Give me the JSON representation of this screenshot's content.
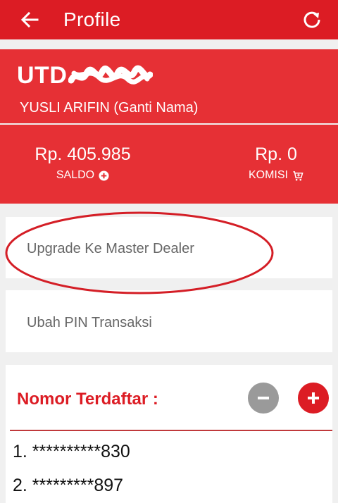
{
  "header": {
    "title": "Profile",
    "back_icon": "arrow-left-icon",
    "refresh_icon": "refresh-icon"
  },
  "profile": {
    "username": "UTD",
    "display_name": "YUSLI ARIFIN (Ganti Nama)"
  },
  "balance": {
    "saldo_amount": "Rp. 405.985",
    "saldo_label": "SALDO",
    "komisi_amount": "Rp. 0",
    "komisi_label": "KOMISI"
  },
  "menu": {
    "upgrade_label": "Upgrade Ke Master Dealer",
    "pin_label": "Ubah PIN Transaksi"
  },
  "registered": {
    "title": "Nomor Terdaftar :",
    "numbers": [
      "1. **********830",
      "2. *********897"
    ]
  },
  "colors": {
    "primary": "#dc1c24",
    "panel": "#e63035",
    "background": "#f0f0f0"
  }
}
